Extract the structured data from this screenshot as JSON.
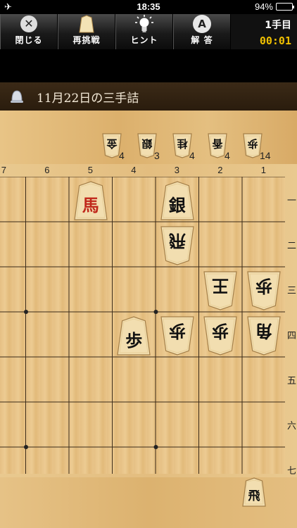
{
  "status": {
    "time": "18:35",
    "battery": "94%",
    "battery_level": 0.94,
    "airplane_glyph": "✈"
  },
  "toolbar": {
    "quit_label": "閉じる",
    "retry_label": "再挑戦",
    "hint_label": "ヒント",
    "answer_label": "解 答",
    "answer_icon_text": "A",
    "quit_icon_text": "✕"
  },
  "info": {
    "move_count": "1手目",
    "elapsed": "00:01"
  },
  "title": {
    "text": "11月22日の三手詰"
  },
  "board": {
    "file_labels": [
      "7",
      "6",
      "5",
      "4",
      "3",
      "2",
      "1"
    ],
    "rank_labels": [
      "一",
      "二",
      "三",
      "四",
      "五",
      "六",
      "七"
    ],
    "pieces": [
      {
        "file": 5,
        "rank": 1,
        "char": "馬",
        "owner": "sente",
        "color": "#c0271a"
      },
      {
        "file": 3,
        "rank": 1,
        "char": "銀",
        "owner": "sente",
        "color": "#111111"
      },
      {
        "file": 3,
        "rank": 2,
        "char": "飛",
        "owner": "gote",
        "color": "#111111"
      },
      {
        "file": 2,
        "rank": 3,
        "char": "王",
        "owner": "gote",
        "color": "#111111"
      },
      {
        "file": 1,
        "rank": 3,
        "char": "歩",
        "owner": "gote",
        "color": "#111111"
      },
      {
        "file": 4,
        "rank": 4,
        "char": "歩",
        "owner": "sente",
        "color": "#111111"
      },
      {
        "file": 3,
        "rank": 4,
        "char": "歩",
        "owner": "gote",
        "color": "#111111"
      },
      {
        "file": 2,
        "rank": 4,
        "char": "歩",
        "owner": "gote",
        "color": "#111111"
      },
      {
        "file": 1,
        "rank": 4,
        "char": "角",
        "owner": "gote",
        "color": "#111111"
      }
    ]
  },
  "gote_hand": [
    {
      "char": "金",
      "count": "4"
    },
    {
      "char": "銀",
      "count": "3"
    },
    {
      "char": "桂",
      "count": "4"
    },
    {
      "char": "香",
      "count": "4"
    },
    {
      "char": "歩",
      "count": "14"
    }
  ],
  "sente_hand": [
    {
      "char": "飛",
      "count": ""
    }
  ]
}
